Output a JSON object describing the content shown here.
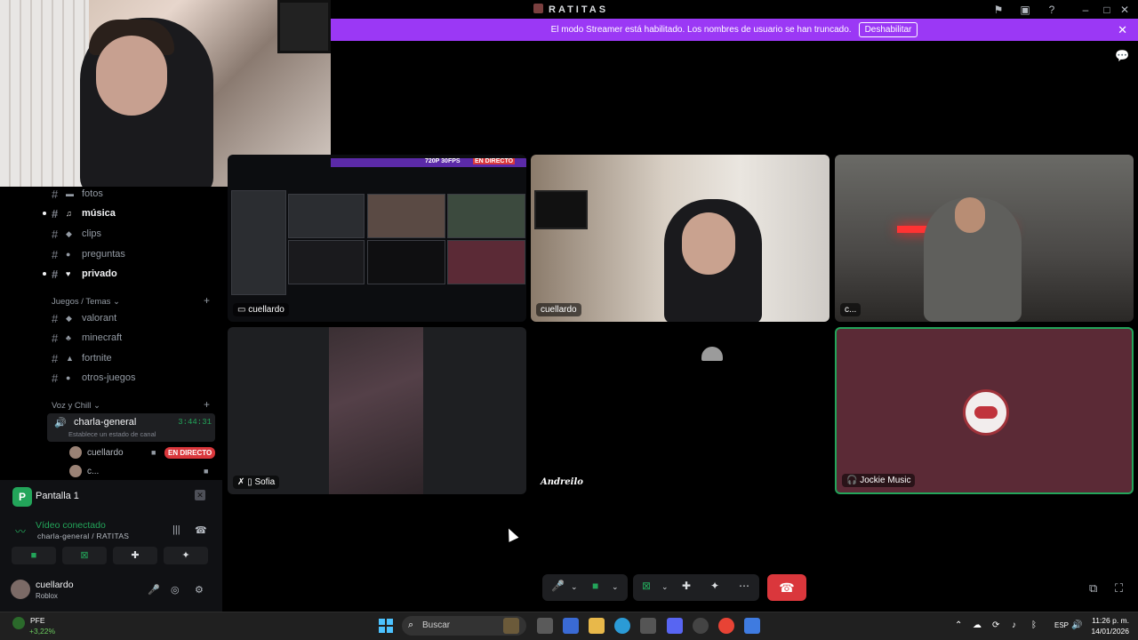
{
  "app": {
    "title": "RATITAS"
  },
  "banner": {
    "text": "El modo Streamer está habilitado. Los nombres de usuario se han truncado.",
    "button": "Deshabilitar"
  },
  "channels": [
    {
      "name": "fotos",
      "emoji": "image"
    },
    {
      "name": "música",
      "emoji": "music"
    },
    {
      "name": "clips",
      "emoji": "gamepad"
    },
    {
      "name": "preguntas",
      "emoji": "thinking"
    },
    {
      "name": "privado",
      "emoji": "hearts"
    }
  ],
  "category_games": "Juegos / Temas",
  "game_channels": [
    {
      "name": "valorant"
    },
    {
      "name": "minecraft"
    },
    {
      "name": "fortnite"
    },
    {
      "name": "otros-juegos"
    }
  ],
  "category_voice": "Voz y Chill",
  "voice_channel": {
    "name": "charla-general",
    "timer": "3:44:31",
    "status_placeholder": "Establece un estado de canal",
    "members": [
      {
        "name": "cuellardo",
        "live": "EN DIRECTO"
      },
      {
        "name": "c..."
      }
    ]
  },
  "screen_panel": {
    "title": "Pantalla 1",
    "connection": "Vídeo conectado",
    "location": "charla-general / RATITAS"
  },
  "user": {
    "name": "cuellardo",
    "status": "Roblox"
  },
  "stream_tile": {
    "label": "cuellardo",
    "quality": "720P 30FPS",
    "live": "EN DIRECTO"
  },
  "tiles": {
    "cam1": "cuellardo",
    "cam2": "c...",
    "sofia": "Sofia",
    "andreilo": "Andreilo",
    "jockie": "Jockie Music"
  },
  "taskbar": {
    "stock_name": "PFE",
    "stock_change": "+3,22%",
    "search": "Buscar",
    "lang": "ESP",
    "time": "11:26 p. m.",
    "date": "14/01/2026"
  },
  "colors": {
    "banner": "#9b38f5",
    "live_badge": "#da373c",
    "connected": "#23a55a",
    "hangup": "#da373c"
  }
}
